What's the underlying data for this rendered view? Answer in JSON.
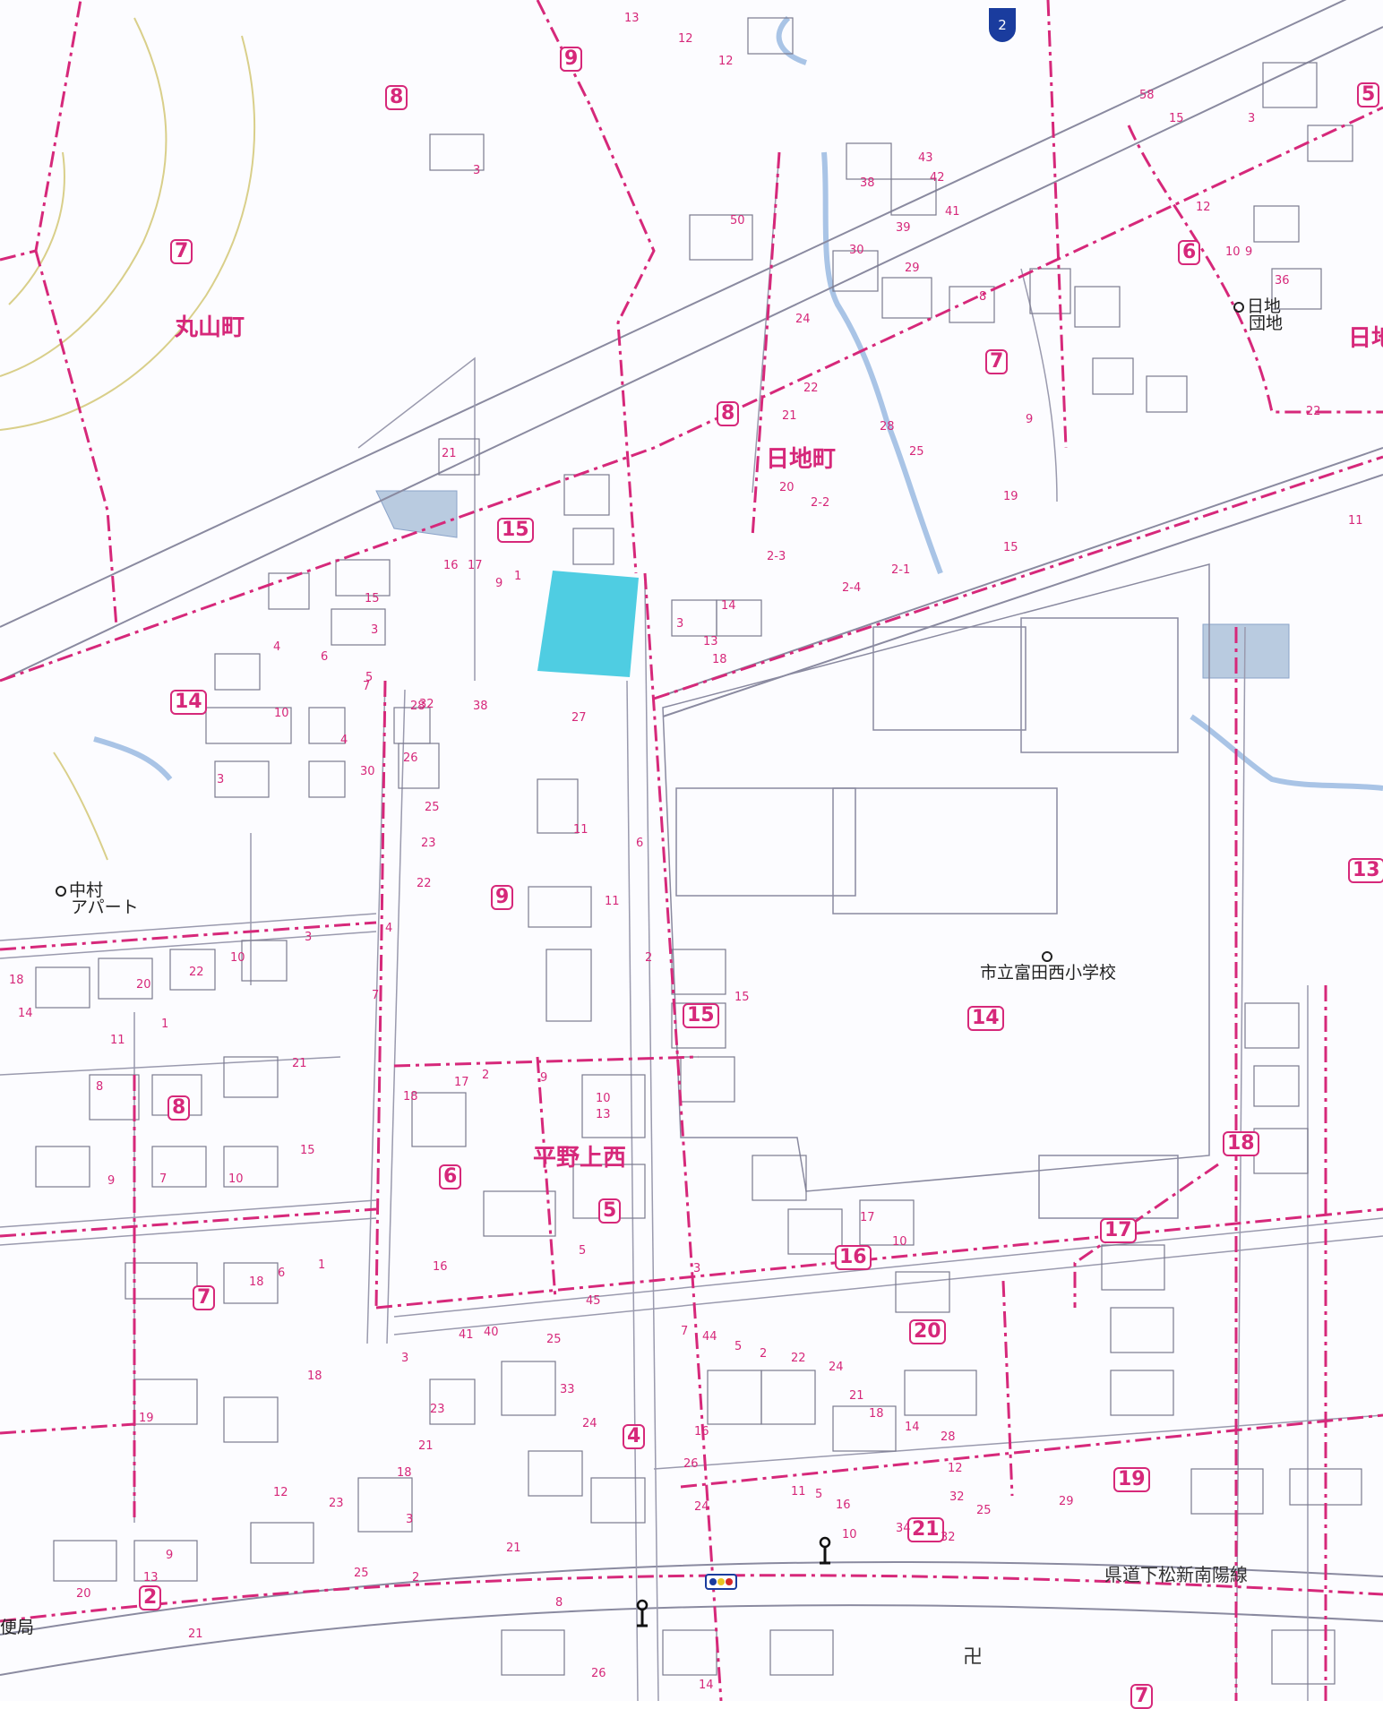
{
  "map": {
    "colors": {
      "boundary": "#d6287a",
      "road_edge": "#8a8aa0",
      "building": "#7a7a8e",
      "water": "#a9c4e6",
      "highlight": "#3cc8df",
      "contour": "#d9cf8a",
      "pond": "#b9cbe0"
    },
    "towns": [
      {
        "id": "maruyama",
        "label": "丸山町"
      },
      {
        "id": "hiji",
        "label": "日地町"
      },
      {
        "id": "hiranokami",
        "label": "平野上西"
      },
      {
        "id": "hiji-edge",
        "label": "日地"
      }
    ],
    "chome_markers": [
      "8",
      "9",
      "7",
      "5",
      "6",
      "7",
      "8",
      "15",
      "14",
      "9",
      "15",
      "14",
      "13",
      "8",
      "6",
      "7",
      "5",
      "4",
      "2",
      "18",
      "17",
      "16",
      "20",
      "19",
      "21",
      "7"
    ],
    "lot_numbers": [
      "13",
      "12",
      "12",
      "3",
      "50",
      "43",
      "42",
      "41",
      "39",
      "38",
      "30",
      "29",
      "24",
      "22",
      "21",
      "8",
      "9",
      "25",
      "28",
      "20",
      "2-2",
      "2-3",
      "2-4",
      "2-1",
      "3",
      "13",
      "14",
      "18",
      "19",
      "15",
      "58",
      "15",
      "3",
      "12",
      "10",
      "9",
      "36",
      "22",
      "11",
      "21",
      "16",
      "17",
      "9",
      "1",
      "3",
      "15",
      "5",
      "4",
      "6",
      "7",
      "10",
      "3",
      "4",
      "30",
      "32",
      "38",
      "28",
      "27",
      "26",
      "25",
      "23",
      "22",
      "4",
      "7",
      "11",
      "11",
      "6",
      "2",
      "15",
      "18",
      "14",
      "22",
      "20",
      "10",
      "11",
      "1",
      "21",
      "3",
      "18",
      "8",
      "9",
      "7",
      "10",
      "15",
      "1",
      "6",
      "18",
      "17",
      "2",
      "9",
      "10",
      "13",
      "16",
      "5",
      "3",
      "17",
      "10",
      "45",
      "44",
      "41",
      "40",
      "3",
      "25",
      "33",
      "24",
      "18",
      "19",
      "23",
      "21",
      "18",
      "3",
      "21",
      "2",
      "8",
      "9",
      "13",
      "20",
      "21",
      "12",
      "23",
      "25",
      "7",
      "5",
      "2",
      "24",
      "22",
      "21",
      "18",
      "16",
      "26",
      "24",
      "11",
      "5",
      "16",
      "14",
      "12",
      "32",
      "25",
      "28",
      "29",
      "34",
      "32",
      "10",
      "14",
      "26"
    ],
    "pois": [
      {
        "id": "hiji-danchi",
        "label_line1": "日地",
        "label_line2": "団地"
      },
      {
        "id": "nakamura-apart",
        "label_line1": "中村",
        "label_line2": "アパート"
      },
      {
        "id": "school",
        "label": "市立富田西小学校"
      }
    ],
    "road_label": "県道下松新南陽線",
    "route_shield": "2",
    "temple_symbol": "卍",
    "post_office_fragment": "便局"
  }
}
